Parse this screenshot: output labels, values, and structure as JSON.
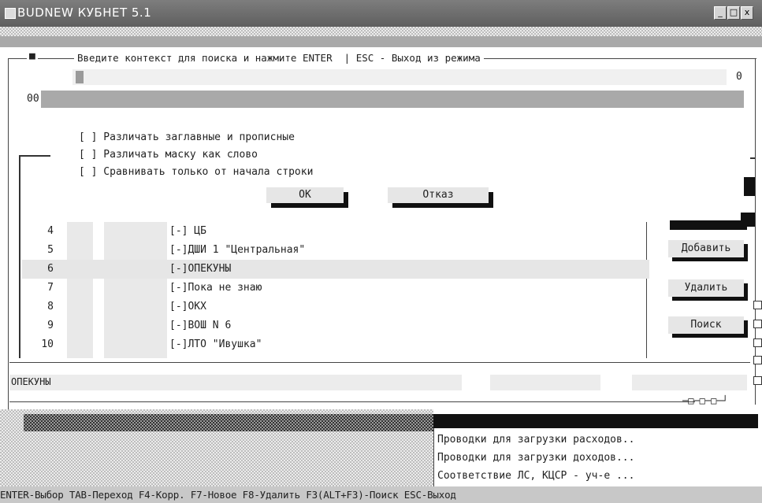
{
  "window": {
    "title": "BUDNEW КУБНЕТ 5.1",
    "buttons": [
      "_",
      "□",
      "x"
    ]
  },
  "search": {
    "prompt": "Введите контекст для поиска и нажмите ENTER  | ESC - Выход из режима",
    "indicator": "■",
    "counter_left": "00",
    "counter_right": "0",
    "options": [
      "[ ] Различать заглавные и прописные",
      "[ ] Различать маску как слово",
      "[ ] Сравнивать только от начала строки"
    ],
    "ok_label": "ОК",
    "cancel_label": "Отказ"
  },
  "list": {
    "rows": [
      {
        "num": "4",
        "item": "[-] ЦБ"
      },
      {
        "num": "5",
        "item": "[-]ДШИ 1 \"Центральная\""
      },
      {
        "num": "6",
        "item": "[-]ОПЕКУНЫ"
      },
      {
        "num": "7",
        "item": "[-]Пока не знаю"
      },
      {
        "num": "8",
        "item": "[-]ОКХ"
      },
      {
        "num": "9",
        "item": "[-]ВОШ N 6"
      },
      {
        "num": "10",
        "item": "[-]ЛТО \"Ивушка\""
      }
    ],
    "selected_index": 2,
    "current_value": "ОПЕКУНЫ"
  },
  "side_buttons": {
    "add": "Добавить",
    "delete": "Удалить",
    "search": "Поиск"
  },
  "footer_marks": "─□─□─□─┘",
  "reports": [
    "Проводки для загрузки расходов..",
    "Проводки для загрузки доходов...",
    "Соответствие ЛС, КЦСР - уч-е ..."
  ],
  "status": "ENTER-Выбор TAB-Переход F4-Корр. F7-Новое F8-Удалить F3(ALT+F3)-Поиск ESC-Выход"
}
